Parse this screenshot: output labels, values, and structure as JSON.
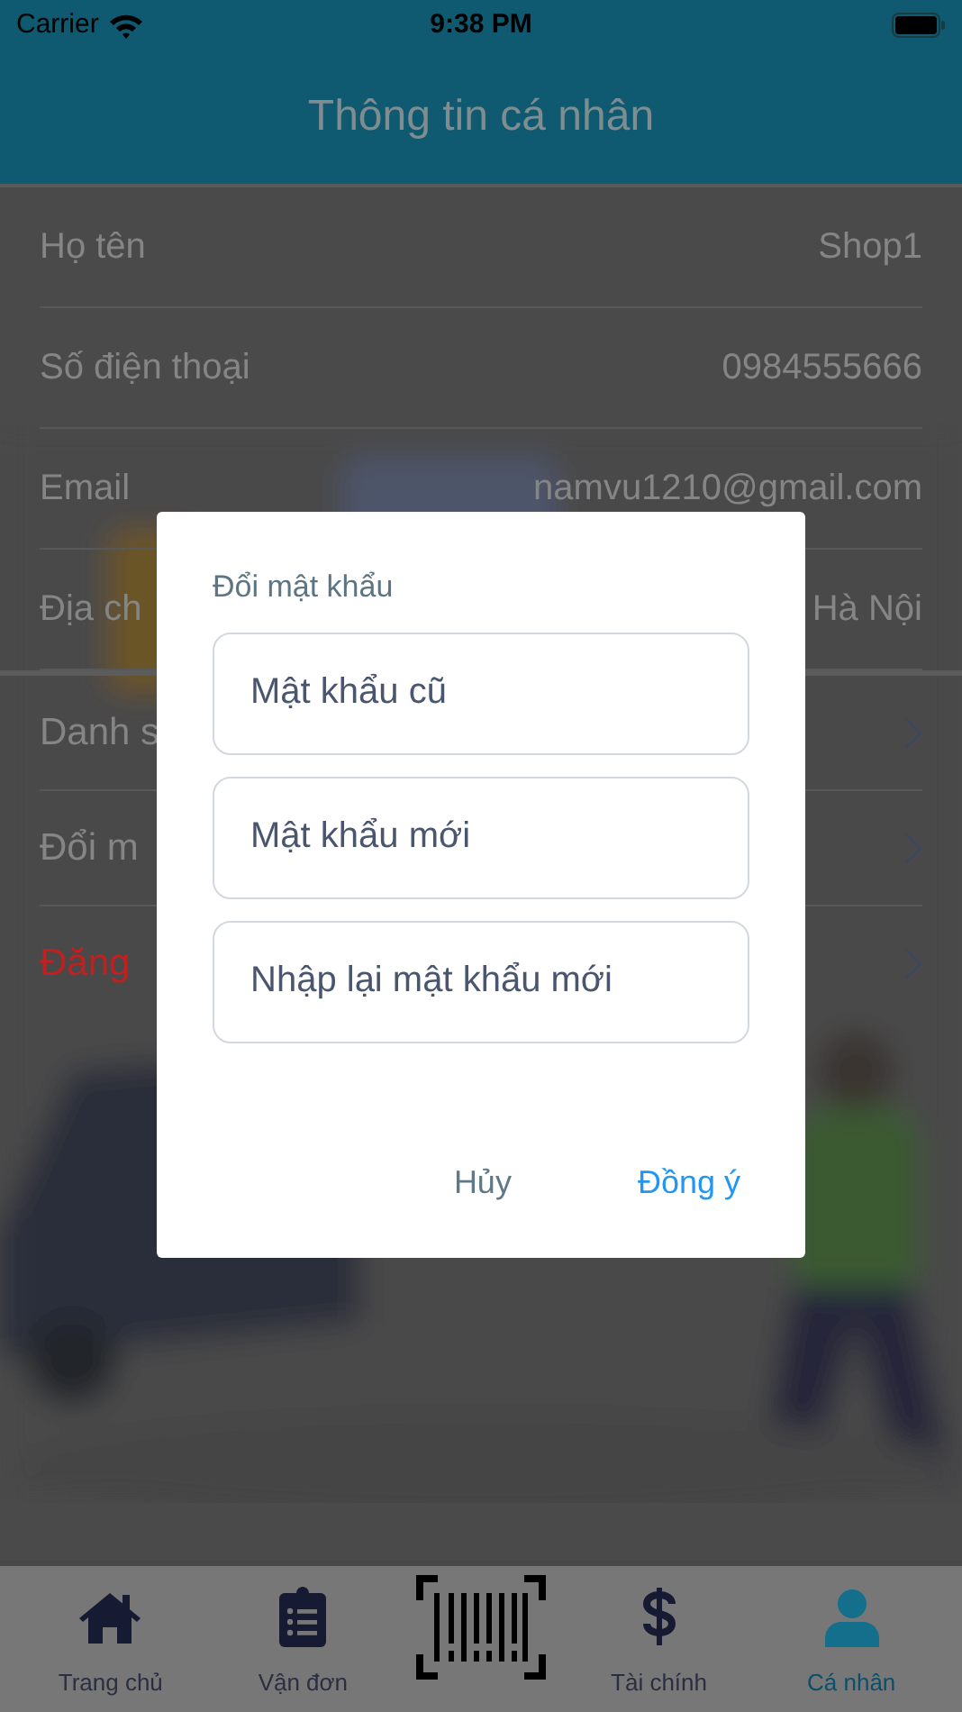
{
  "status_bar": {
    "carrier": "Carrier",
    "time": "9:38 PM"
  },
  "header": {
    "title": "Thông tin cá nhân"
  },
  "profile_fields": [
    {
      "label": "Họ tên",
      "value": "Shop1"
    },
    {
      "label": "Số điện thoại",
      "value": "0984555666"
    },
    {
      "label": "Email",
      "value": "namvu1210@gmail.com"
    },
    {
      "label": "Địa ch",
      "value": "Hà Nội"
    }
  ],
  "menu_items": [
    {
      "label": "Danh s",
      "kind": "normal"
    },
    {
      "label": "Đổi m",
      "kind": "normal"
    },
    {
      "label": "Đăng",
      "kind": "danger"
    }
  ],
  "dialog": {
    "title": "Đổi mật khẩu",
    "fields": [
      {
        "placeholder": "Mật khẩu cũ"
      },
      {
        "placeholder": "Mật khẩu mới"
      },
      {
        "placeholder": "Nhập lại mật khẩu mới"
      }
    ],
    "buttons": [
      {
        "label": "Hủy",
        "kind": "cancel"
      },
      {
        "label": "Đồng ý",
        "kind": "confirm"
      }
    ]
  },
  "tab_bar": [
    {
      "kind": "tab",
      "label": "Trang chủ",
      "selected": false
    },
    {
      "kind": "tab",
      "label": "Vận đơn",
      "selected": false
    },
    {
      "kind": "scan"
    },
    {
      "kind": "tab",
      "label": "Tài chính",
      "selected": false
    },
    {
      "kind": "tab",
      "label": "Cá nhân",
      "selected": true
    }
  ]
}
